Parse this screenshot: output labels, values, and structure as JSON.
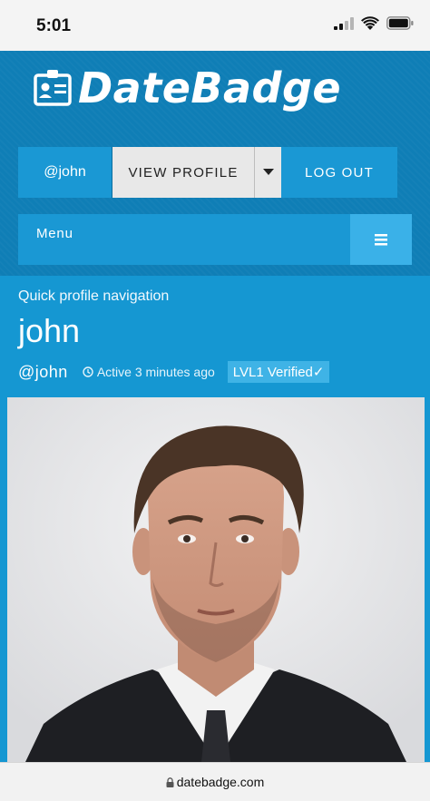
{
  "status_bar": {
    "time": "5:01"
  },
  "header": {
    "logo_text": "DateBadge",
    "nav": {
      "username": "@john",
      "view_profile": "VIEW PROFILE",
      "logout": "LOG OUT"
    },
    "menu_label": "Menu"
  },
  "profile": {
    "quick_nav": "Quick profile navigation",
    "name": "john",
    "handle": "@john",
    "active": "Active 3 minutes ago",
    "badge": "LVL1 Verified✓"
  },
  "url_bar": {
    "url": "datebadge.com"
  },
  "colors": {
    "brand_blue": "#0f7eb6",
    "button_blue": "#1a98d4",
    "profile_blue": "#1597d2",
    "badge_blue": "#3fb3e6"
  },
  "icons": [
    "signal-icon",
    "wifi-icon",
    "battery-icon",
    "id-badge-icon",
    "caret-down-icon",
    "hamburger-icon",
    "clock-icon",
    "lock-icon"
  ]
}
